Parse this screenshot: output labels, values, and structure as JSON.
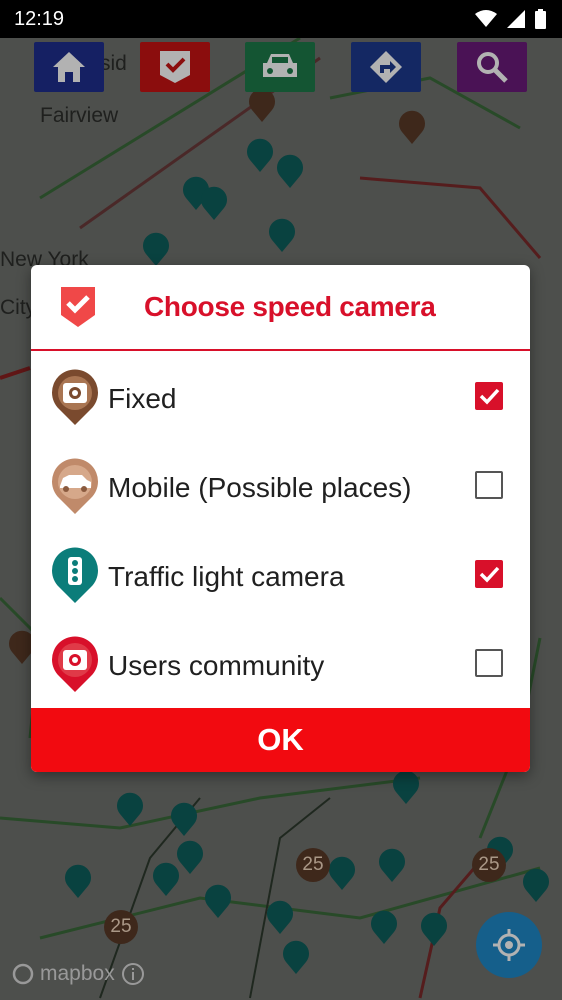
{
  "status_bar": {
    "time": "12:19"
  },
  "map": {
    "labels": [
      "Fairview",
      "New York",
      "City",
      "sid"
    ],
    "attribution": "mapbox",
    "badges": [
      "25",
      "25",
      "25"
    ]
  },
  "toolbar": {
    "buttons": [
      {
        "name": "home",
        "color": "#1f2f8f"
      },
      {
        "name": "speed-camera",
        "color": "#c81414"
      },
      {
        "name": "car",
        "color": "#1e7a4a"
      },
      {
        "name": "directions",
        "color": "#1d3a8f"
      },
      {
        "name": "search",
        "color": "#6a1a7a"
      }
    ]
  },
  "dialog": {
    "title": "Choose speed camera",
    "options": [
      {
        "label": "Fixed",
        "checked": true,
        "icon": "fixed-camera-icon",
        "color": "#7a4a2e"
      },
      {
        "label": "Mobile (Possible places)",
        "checked": false,
        "icon": "mobile-camera-icon",
        "color": "#c08a6a"
      },
      {
        "label": "Traffic light camera",
        "checked": true,
        "icon": "traffic-light-icon",
        "color": "#0b7d7a"
      },
      {
        "label": "Users community",
        "checked": false,
        "icon": "users-community-icon",
        "color": "#d8102a"
      }
    ],
    "ok_label": "OK"
  },
  "colors": {
    "accent": "#d8102a",
    "ok_button": "#f20a10"
  }
}
